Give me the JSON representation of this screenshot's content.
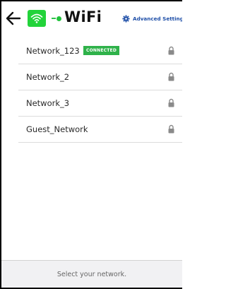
{
  "header": {
    "title": "WiFi",
    "advanced_label": "Advanced Settings",
    "back_icon": "arrow-left-icon",
    "wifi_icon": "wifi-icon",
    "gear_icon": "gear-icon"
  },
  "networks": [
    {
      "name": "Network_123",
      "status": "CONNECTED",
      "secured": true
    },
    {
      "name": "Network_2",
      "status": "",
      "secured": true
    },
    {
      "name": "Network_3",
      "status": "",
      "secured": true
    },
    {
      "name": "Guest_Network",
      "status": "",
      "secured": true
    }
  ],
  "footer": {
    "hint": "Select your network."
  },
  "colors": {
    "accent_green": "#22d33a",
    "connected_badge": "#2fb24a",
    "link_blue": "#1f4fa8",
    "footer_bg": "#f1f1f3"
  }
}
